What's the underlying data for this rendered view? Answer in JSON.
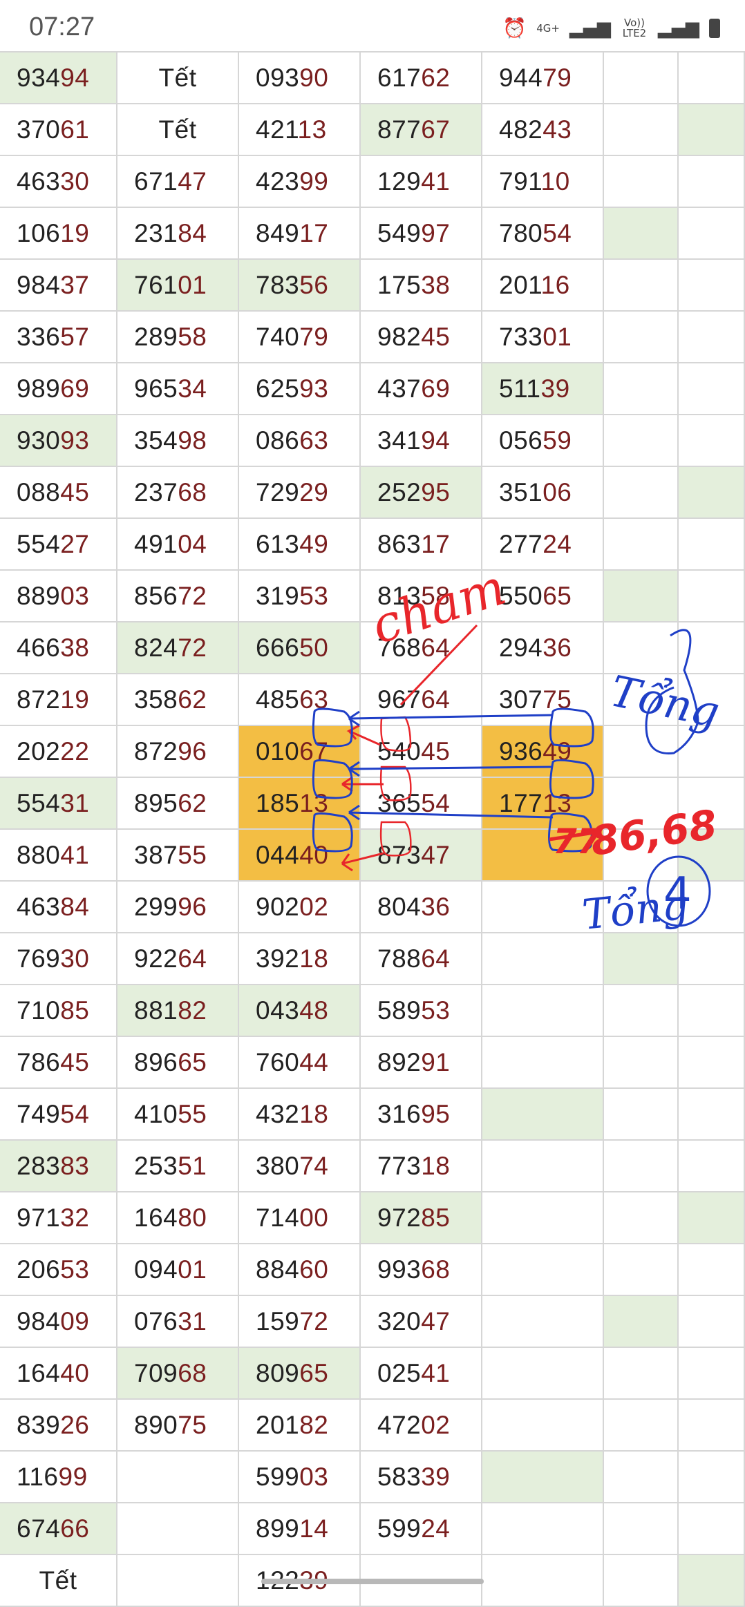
{
  "status_bar": {
    "time": "07:27",
    "icons": [
      "alarm-icon",
      "network-4g-icon",
      "signal-icon",
      "volte-icon",
      "signal-icon",
      "battery-icon"
    ],
    "network_label": "4G+",
    "volte_label": "Vo)) LTE2"
  },
  "table": {
    "columns": 7,
    "rows": [
      [
        {
          "t": "93494",
          "g": 1
        },
        {
          "t": "Tết"
        },
        {
          "t": "09390"
        },
        {
          "t": "61762"
        },
        {
          "t": "94479"
        },
        {
          "t": ""
        },
        {
          "t": ""
        }
      ],
      [
        {
          "t": "37061"
        },
        {
          "t": "Tết"
        },
        {
          "t": "42113"
        },
        {
          "t": "87767",
          "g": 1
        },
        {
          "t": "48243"
        },
        {
          "t": ""
        },
        {
          "t": "",
          "g": 1
        }
      ],
      [
        {
          "t": "46330"
        },
        {
          "t": "67147"
        },
        {
          "t": "42399"
        },
        {
          "t": "12941"
        },
        {
          "t": "79110"
        },
        {
          "t": ""
        },
        {
          "t": ""
        }
      ],
      [
        {
          "t": "10619"
        },
        {
          "t": "23184"
        },
        {
          "t": "84917"
        },
        {
          "t": "54997"
        },
        {
          "t": "78054"
        },
        {
          "t": "",
          "g": 1
        },
        {
          "t": ""
        }
      ],
      [
        {
          "t": "98437"
        },
        {
          "t": "76101",
          "g": 1
        },
        {
          "t": "78356",
          "g": 1
        },
        {
          "t": "17538"
        },
        {
          "t": "20116"
        },
        {
          "t": ""
        },
        {
          "t": ""
        }
      ],
      [
        {
          "t": "33657"
        },
        {
          "t": "28958"
        },
        {
          "t": "74079"
        },
        {
          "t": "98245"
        },
        {
          "t": "73301"
        },
        {
          "t": ""
        },
        {
          "t": ""
        }
      ],
      [
        {
          "t": "98969"
        },
        {
          "t": "96534"
        },
        {
          "t": "62593"
        },
        {
          "t": "43769"
        },
        {
          "t": "51139",
          "g": 1
        },
        {
          "t": ""
        },
        {
          "t": ""
        }
      ],
      [
        {
          "t": "93093",
          "g": 1
        },
        {
          "t": "35498"
        },
        {
          "t": "08663"
        },
        {
          "t": "34194"
        },
        {
          "t": "05659"
        },
        {
          "t": ""
        },
        {
          "t": ""
        }
      ],
      [
        {
          "t": "08845"
        },
        {
          "t": "23768"
        },
        {
          "t": "72929"
        },
        {
          "t": "25295",
          "g": 1
        },
        {
          "t": "35106"
        },
        {
          "t": ""
        },
        {
          "t": "",
          "g": 1
        }
      ],
      [
        {
          "t": "55427"
        },
        {
          "t": "49104"
        },
        {
          "t": "61349"
        },
        {
          "t": "86317"
        },
        {
          "t": "27724"
        },
        {
          "t": ""
        },
        {
          "t": ""
        }
      ],
      [
        {
          "t": "88903"
        },
        {
          "t": "85672"
        },
        {
          "t": "31953"
        },
        {
          "t": "81358"
        },
        {
          "t": "55065"
        },
        {
          "t": "",
          "g": 1
        },
        {
          "t": ""
        }
      ],
      [
        {
          "t": "46638"
        },
        {
          "t": "82472",
          "g": 1
        },
        {
          "t": "66650",
          "g": 1
        },
        {
          "t": "76864"
        },
        {
          "t": "29436"
        },
        {
          "t": ""
        },
        {
          "t": ""
        }
      ],
      [
        {
          "t": "87219"
        },
        {
          "t": "35862"
        },
        {
          "t": "48563"
        },
        {
          "t": "96764"
        },
        {
          "t": "30775"
        },
        {
          "t": ""
        },
        {
          "t": ""
        }
      ],
      [
        {
          "t": "20222"
        },
        {
          "t": "87296"
        },
        {
          "t": "01067",
          "o": 1
        },
        {
          "t": "54045"
        },
        {
          "t": "93649",
          "o": 1
        },
        {
          "t": ""
        },
        {
          "t": ""
        }
      ],
      [
        {
          "t": "55431",
          "g": 1
        },
        {
          "t": "89562"
        },
        {
          "t": "18513",
          "o": 1
        },
        {
          "t": "36554"
        },
        {
          "t": "17713",
          "o": 1
        },
        {
          "t": ""
        },
        {
          "t": ""
        }
      ],
      [
        {
          "t": "88041"
        },
        {
          "t": "38755"
        },
        {
          "t": "04440",
          "o": 1
        },
        {
          "t": "87347",
          "g": 1
        },
        {
          "t": "",
          "o": 1
        },
        {
          "t": ""
        },
        {
          "t": "",
          "g": 1
        }
      ],
      [
        {
          "t": "46384"
        },
        {
          "t": "29996"
        },
        {
          "t": "90202"
        },
        {
          "t": "80436"
        },
        {
          "t": ""
        },
        {
          "t": ""
        },
        {
          "t": ""
        }
      ],
      [
        {
          "t": "76930"
        },
        {
          "t": "92264"
        },
        {
          "t": "39218"
        },
        {
          "t": "78864"
        },
        {
          "t": ""
        },
        {
          "t": "",
          "g": 1
        },
        {
          "t": ""
        }
      ],
      [
        {
          "t": "71085"
        },
        {
          "t": "88182",
          "g": 1
        },
        {
          "t": "04348",
          "g": 1
        },
        {
          "t": "58953"
        },
        {
          "t": ""
        },
        {
          "t": ""
        },
        {
          "t": ""
        }
      ],
      [
        {
          "t": "78645"
        },
        {
          "t": "89665"
        },
        {
          "t": "76044"
        },
        {
          "t": "89291"
        },
        {
          "t": ""
        },
        {
          "t": ""
        },
        {
          "t": ""
        }
      ],
      [
        {
          "t": "74954"
        },
        {
          "t": "41055"
        },
        {
          "t": "43218"
        },
        {
          "t": "31695"
        },
        {
          "t": "",
          "g": 1
        },
        {
          "t": ""
        },
        {
          "t": ""
        }
      ],
      [
        {
          "t": "28383",
          "g": 1
        },
        {
          "t": "25351"
        },
        {
          "t": "38074"
        },
        {
          "t": "77318"
        },
        {
          "t": ""
        },
        {
          "t": ""
        },
        {
          "t": ""
        }
      ],
      [
        {
          "t": "97132"
        },
        {
          "t": "16480"
        },
        {
          "t": "71400"
        },
        {
          "t": "97285",
          "g": 1
        },
        {
          "t": ""
        },
        {
          "t": ""
        },
        {
          "t": "",
          "g": 1
        }
      ],
      [
        {
          "t": "20653"
        },
        {
          "t": "09401"
        },
        {
          "t": "88460"
        },
        {
          "t": "99368"
        },
        {
          "t": ""
        },
        {
          "t": ""
        },
        {
          "t": ""
        }
      ],
      [
        {
          "t": "98409"
        },
        {
          "t": "07631"
        },
        {
          "t": "15972"
        },
        {
          "t": "32047"
        },
        {
          "t": ""
        },
        {
          "t": "",
          "g": 1
        },
        {
          "t": ""
        }
      ],
      [
        {
          "t": "16440"
        },
        {
          "t": "70968",
          "g": 1
        },
        {
          "t": "80965",
          "g": 1
        },
        {
          "t": "02541"
        },
        {
          "t": ""
        },
        {
          "t": ""
        },
        {
          "t": ""
        }
      ],
      [
        {
          "t": "83926"
        },
        {
          "t": "89075"
        },
        {
          "t": "20182"
        },
        {
          "t": "47202"
        },
        {
          "t": ""
        },
        {
          "t": ""
        },
        {
          "t": ""
        }
      ],
      [
        {
          "t": "11699"
        },
        {
          "t": ""
        },
        {
          "t": "59903"
        },
        {
          "t": "58339"
        },
        {
          "t": "",
          "g": 1
        },
        {
          "t": ""
        },
        {
          "t": ""
        }
      ],
      [
        {
          "t": "67466",
          "g": 1
        },
        {
          "t": ""
        },
        {
          "t": "89914"
        },
        {
          "t": "59924"
        },
        {
          "t": ""
        },
        {
          "t": ""
        },
        {
          "t": ""
        }
      ],
      [
        {
          "t": "Tết"
        },
        {
          "t": ""
        },
        {
          "t": "12239"
        },
        {
          "t": ""
        },
        {
          "t": ""
        },
        {
          "t": ""
        },
        {
          "t": "",
          "g": 1
        }
      ]
    ]
  },
  "annotations": {
    "red_word": "cham",
    "blue_word_top": "Tổng",
    "blue_word_bottom": "Tổng",
    "circled_number": "4",
    "red_numbers": "86,68",
    "struck_number": "77"
  },
  "colors": {
    "green_cell": "#e4efdc",
    "orange_cell": "#f3be44",
    "digit_highlight": "#7a1f1f",
    "annotation_red": "#e8262b",
    "annotation_blue": "#1f3fc7"
  }
}
